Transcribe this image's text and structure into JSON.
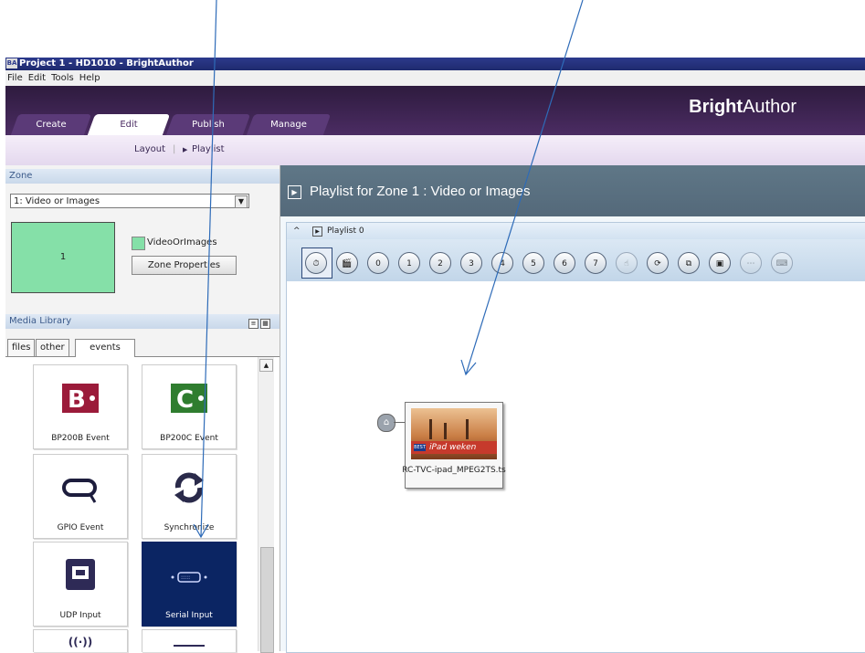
{
  "window": {
    "title": "Project 1 - HD1010 - BrightAuthor",
    "app_icon": "BA"
  },
  "menu": [
    "File",
    "Edit",
    "Tools",
    "Help"
  ],
  "brand": {
    "bold": "Bright",
    "light": "Author"
  },
  "tabs": [
    {
      "label": "Create",
      "active": false
    },
    {
      "label": "Edit",
      "active": true
    },
    {
      "label": "Publish",
      "active": false
    },
    {
      "label": "Manage",
      "active": false
    }
  ],
  "subnav": {
    "layout": "Layout",
    "playlist": "Playlist"
  },
  "zone": {
    "header": "Zone",
    "selected": "1: Video or Images",
    "preview_label": "1",
    "type_label": "VideoOrImages",
    "properties_button": "Zone Properties"
  },
  "media_library": {
    "header": "Media Library",
    "tabs": [
      "files",
      "other",
      "events"
    ],
    "active_tab": "events",
    "items": [
      {
        "label": "BP200B Event",
        "icon": "bp200b-icon"
      },
      {
        "label": "BP200C Event",
        "icon": "bp200c-icon"
      },
      {
        "label": "GPIO Event",
        "icon": "gpio-icon"
      },
      {
        "label": "Synchronize",
        "icon": "synchronize-icon"
      },
      {
        "label": "UDP Input",
        "icon": "udp-input-icon"
      },
      {
        "label": "Serial Input",
        "icon": "serial-input-icon",
        "selected": true
      },
      {
        "label": "",
        "icon": "wireless-icon"
      },
      {
        "label": "",
        "icon": "keyboard-icon"
      }
    ]
  },
  "playlist": {
    "header": "Playlist for Zone 1 : Video or Images",
    "sub_header": "Playlist 0",
    "toolbar": [
      "timeout",
      "media-end",
      "0",
      "1",
      "2",
      "3",
      "4",
      "5",
      "6",
      "7",
      "touch",
      "synchronize",
      "zone-message",
      "udp",
      "serial",
      "keyboard"
    ],
    "node": {
      "label": "RC-TVC-ipad_MPEG2TS.ts",
      "thumbnail_text": "iPad weken",
      "badge": "BEST"
    }
  },
  "colors": {
    "header_purple": "#4b2c63",
    "selected_tile": "#0b2563",
    "zone_green": "#85e0a8",
    "arrow": "#2e6bb8"
  }
}
